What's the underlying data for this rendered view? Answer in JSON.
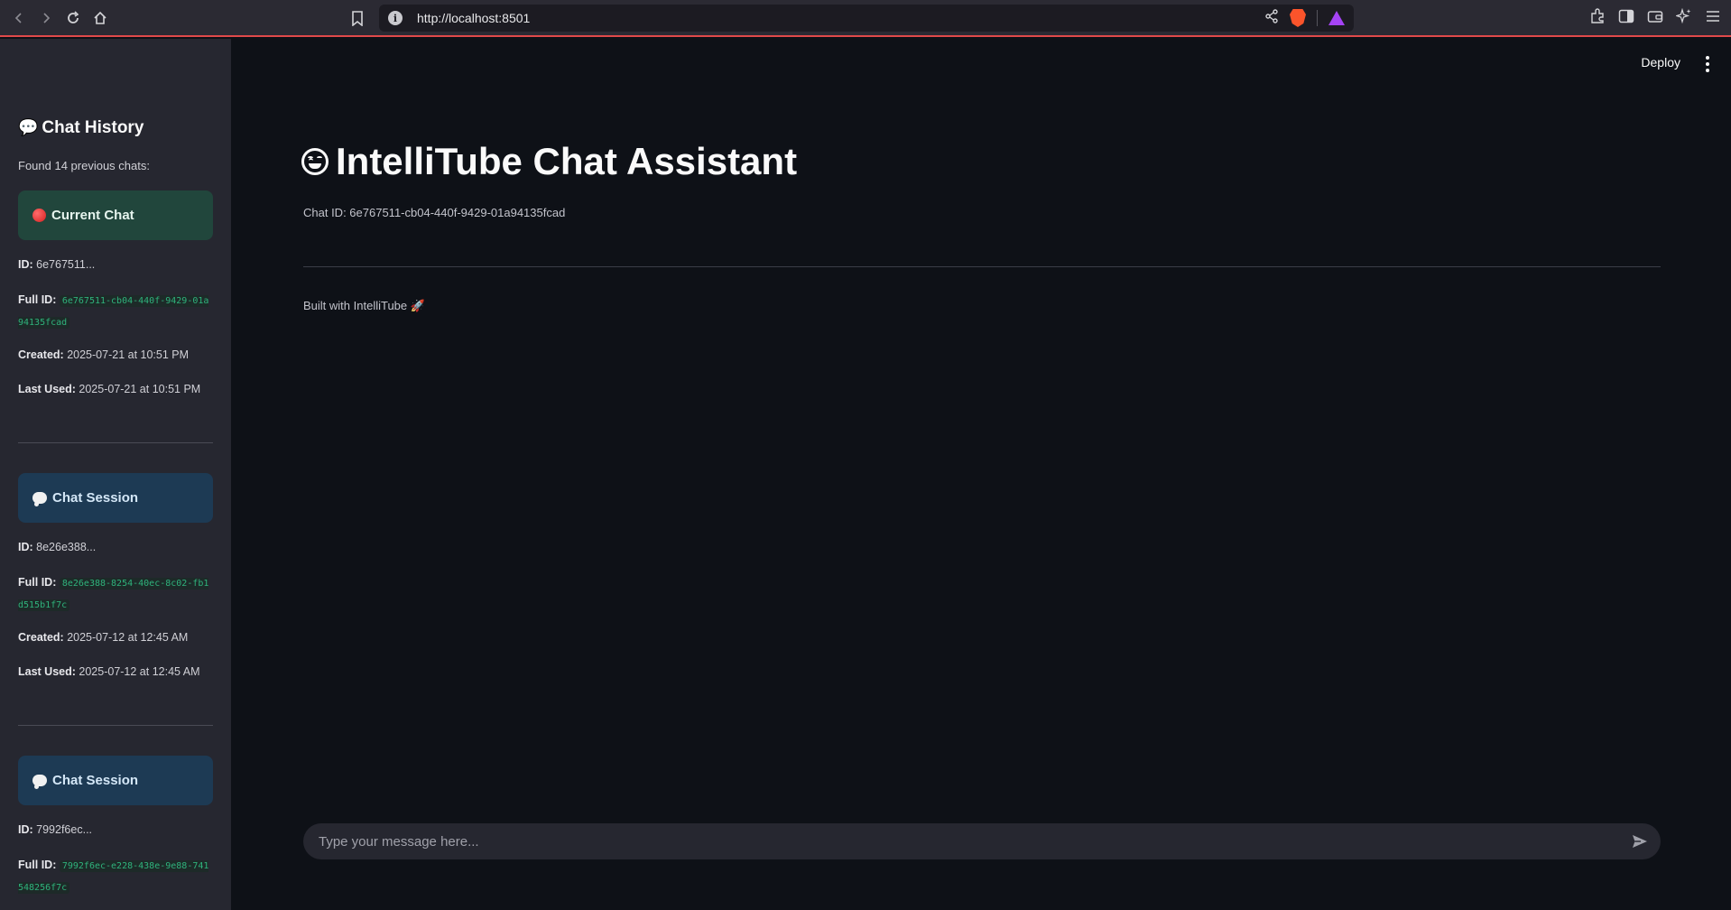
{
  "browser": {
    "url": "http://localhost:8501"
  },
  "header": {
    "deploy_label": "Deploy"
  },
  "sidebar": {
    "title": "Chat History",
    "found_text": "Found 14 previous chats:",
    "chats": [
      {
        "card_label": "Current Chat",
        "card_type": "current",
        "id_label": "ID:",
        "id_value": "6e767511...",
        "full_id_label": "Full ID:",
        "full_id": "6e767511-cb04-440f-9429-01a94135fcad",
        "created_label": "Created:",
        "created": "2025-07-21 at 10:51 PM",
        "last_used_label": "Last Used:",
        "last_used": "2025-07-21 at 10:51 PM"
      },
      {
        "card_label": "Chat Session",
        "card_type": "session",
        "id_label": "ID:",
        "id_value": "8e26e388...",
        "full_id_label": "Full ID:",
        "full_id": "8e26e388-8254-40ec-8c02-fb1d515b1f7c",
        "created_label": "Created:",
        "created": "2025-07-12 at 12:45 AM",
        "last_used_label": "Last Used:",
        "last_used": "2025-07-12 at 12:45 AM"
      },
      {
        "card_label": "Chat Session",
        "card_type": "session",
        "id_label": "ID:",
        "id_value": "7992f6ec...",
        "full_id_label": "Full ID:",
        "full_id": "7992f6ec-e228-438e-9e88-741548256f7c"
      }
    ]
  },
  "main": {
    "title": "IntelliTube Chat Assistant",
    "chat_id_text": "Chat ID: 6e767511-cb04-440f-9429-01a94135fcad",
    "footer_text": "Built with IntelliTube 🚀",
    "input_placeholder": "Type your message here..."
  },
  "colors": {
    "accent_green": "#21463c",
    "accent_blue": "#1d3a54",
    "code_green": "#2fb37c",
    "background": "#0e1117",
    "sidebar": "#262730"
  }
}
